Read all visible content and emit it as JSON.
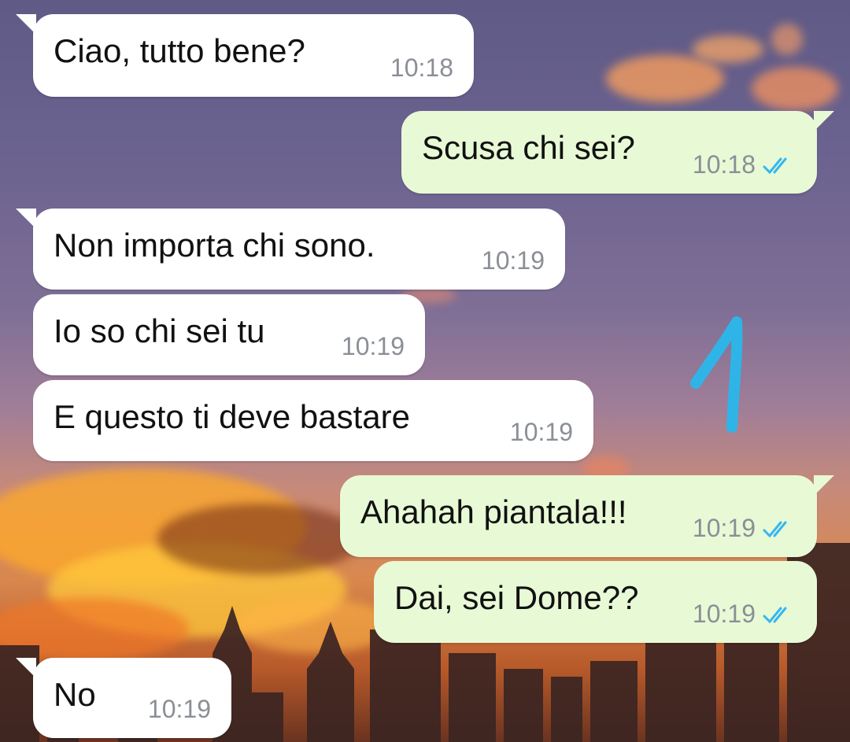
{
  "messages": [
    {
      "direction": "in",
      "text": "Ciao, tutto bene?",
      "time": "10:18"
    },
    {
      "direction": "out",
      "text": "Scusa chi sei?",
      "time": "10:18",
      "status": "read"
    },
    {
      "direction": "in",
      "text": "Non importa chi sono.",
      "time": "10:19"
    },
    {
      "direction": "in",
      "text": "Io so chi sei tu",
      "time": "10:19"
    },
    {
      "direction": "in",
      "text": "E questo ti deve bastare",
      "time": "10:19"
    },
    {
      "direction": "out",
      "text": "Ahahah piantala!!!",
      "time": "10:19",
      "status": "read"
    },
    {
      "direction": "out",
      "text": "Dai, sei Dome??",
      "time": "10:19",
      "status": "read"
    },
    {
      "direction": "in",
      "text": "No",
      "time": "10:19"
    }
  ],
  "colors": {
    "incoming_bubble": "#ffffff",
    "outgoing_bubble": "#e8f9d6",
    "timestamp": "#8a8f96",
    "read_ticks": "#34b7f1",
    "annotation": "#2fb4e8"
  },
  "icons": {
    "read_status": "double-check-icon"
  }
}
